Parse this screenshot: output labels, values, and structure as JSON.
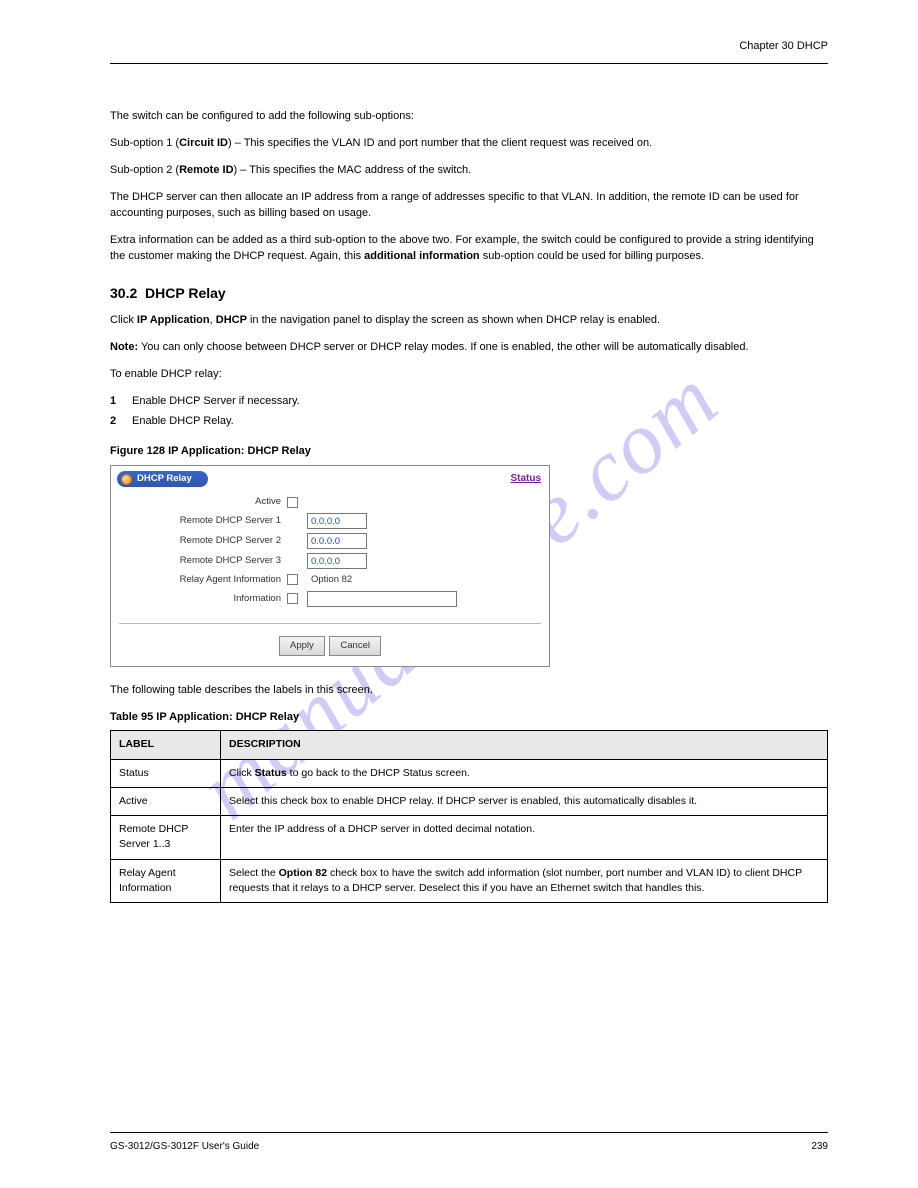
{
  "header": {
    "right": "Chapter 30 DHCP"
  },
  "watermark": "manualshive.com",
  "body": {
    "p1": "The switch can be configured to add the following sub-options:",
    "p2_pre": "Sub-option 1 (",
    "p2_term": "Circuit ID",
    "p2_post": ") – This specifies the VLAN ID and port number that the client request was received on.",
    "p3_pre": "Sub-option 2 (",
    "p3_term": "Remote ID",
    "p3_post": ") – This specifies the MAC address of the switch.",
    "p4": "The DHCP server can then allocate an IP address from a range of addresses specific to that VLAN. In addition, the remote ID can be used for accounting purposes, such as billing based on usage.",
    "p5_pre": "Extra information can be added as a third sub-option to the above two. For example, the switch could be configured to provide a string identifying the customer making the DHCP request. Again, this ",
    "p5_term": "additional information",
    "p5_post": " sub-option could be used for billing purposes."
  },
  "sec302": {
    "num": "30.2",
    "title": "DHCP Relay",
    "p1_a": "Click ",
    "p1_b": "IP Application",
    "p1_c": ", ",
    "p1_d": "DHCP",
    "p1_e": " in the navigation panel to display the screen as shown when DHCP relay is enabled.",
    "note_label": "Note:",
    "note_text": "You can only choose between DHCP server or DHCP relay modes. If one is enabled, the other will be automatically disabled.",
    "steps_intro": "To enable DHCP relay:",
    "steps": [
      "Enable DHCP Server if necessary.",
      "Enable DHCP Relay."
    ],
    "fig_caption": "Figure 128   IP Application: DHCP Relay"
  },
  "figure": {
    "pill_label": "DHCP Relay",
    "status_link": "Status",
    "labels": {
      "active": "Active",
      "rs1": "Remote DHCP Server 1",
      "rs2": "Remote DHCP Server 2",
      "rs3": "Remote DHCP Server 3",
      "rai": "Relay Agent Information",
      "info": "Information",
      "opt82": "Option 82"
    },
    "values": {
      "ip": "0.0.0.0",
      "info_val": ""
    },
    "buttons": {
      "apply": "Apply",
      "cancel": "Cancel"
    }
  },
  "table": {
    "caption": "Table 95   IP Application: DHCP Relay",
    "intro": "The following table describes the labels in this screen.",
    "head": {
      "c1": "LABEL",
      "c2": "DESCRIPTION"
    },
    "rows": [
      {
        "label": "Status",
        "pre": "Click ",
        "bold": "Status",
        "post": " to go back to the DHCP Status screen."
      },
      {
        "label": "Active",
        "desc": "Select this check box to enable DHCP relay. If DHCP server is enabled, this automatically disables it."
      },
      {
        "label": "Remote DHCP Server 1..3",
        "desc": "Enter the IP address of a DHCP server in dotted decimal notation."
      },
      {
        "label": "Relay Agent Information",
        "pre": "Select the ",
        "bold": "Option 82",
        "post": " check box to have the switch add information (slot number, port number and VLAN ID) to client DHCP requests that it relays to a DHCP server. Deselect this if you have an Ethernet switch that handles this."
      }
    ]
  },
  "footer": {
    "left": "GS-3012/GS-3012F User's Guide",
    "right": "239"
  }
}
